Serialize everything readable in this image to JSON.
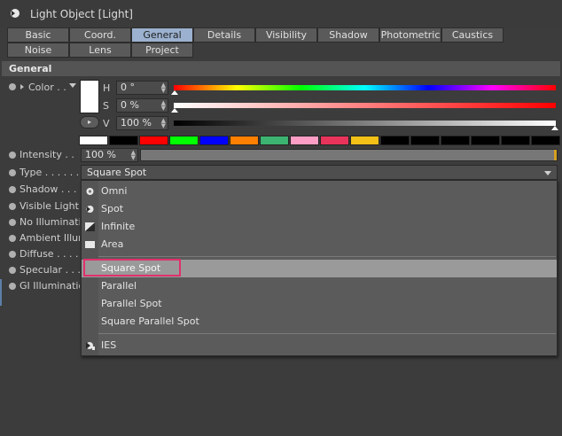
{
  "header": {
    "title": "Light Object [Light]",
    "icon": "light-object-icon"
  },
  "tabs_row1": [
    "Basic",
    "Coord.",
    "General",
    "Details",
    "Visibility",
    "Shadow",
    "Photometric",
    "Caustics"
  ],
  "tabs_row2": [
    "Noise",
    "Lens",
    "Project"
  ],
  "active_tab": "General",
  "section": {
    "title": "General"
  },
  "color": {
    "label": "Color . .",
    "h_label": "H",
    "h_value": "0 °",
    "s_label": "S",
    "s_value": "0 %",
    "v_label": "V",
    "v_value": "100 %",
    "current": "#ffffff",
    "palette": [
      "#ffffff",
      "#000000",
      "#ff0000",
      "#00ff00",
      "#0000ff",
      "#ff8000",
      "#3cb371",
      "#ff9ec4",
      "#e8345a",
      "#f2c017",
      "#000000",
      "#000000",
      "#000000",
      "#000000",
      "#000000",
      "#000000"
    ]
  },
  "intensity": {
    "label": "Intensity . . .",
    "value": "100 %",
    "fraction": 1.0
  },
  "type": {
    "label": "Type . . . . . .",
    "value": "Square Spot"
  },
  "params": [
    "Shadow . . . .",
    "Visible Light",
    "No Illuminatio",
    "Ambient Illum",
    "Diffuse . . . .",
    "Specular . . .",
    "GI Illumination"
  ],
  "dropdown": {
    "group1": [
      {
        "label": "Omni",
        "icon": "omni-icon"
      },
      {
        "label": "Spot",
        "icon": "spot-icon"
      },
      {
        "label": "Infinite",
        "icon": "infinite-icon"
      },
      {
        "label": "Area",
        "icon": "area-icon"
      }
    ],
    "group2": [
      {
        "label": "Square Spot",
        "selected": true
      },
      {
        "label": "Parallel"
      },
      {
        "label": "Parallel Spot"
      },
      {
        "label": "Square Parallel Spot"
      }
    ],
    "group3": [
      {
        "label": "IES",
        "icon": "ies-icon"
      }
    ],
    "highlight_color": "#e0306a"
  }
}
